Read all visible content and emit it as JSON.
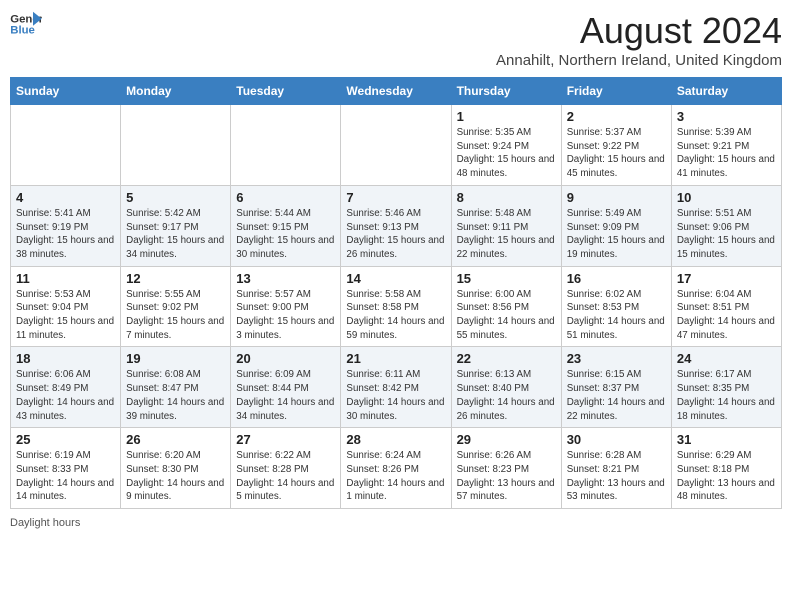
{
  "logo": {
    "line1": "General",
    "line2": "Blue"
  },
  "title": "August 2024",
  "location": "Annahilt, Northern Ireland, United Kingdom",
  "headers": [
    "Sunday",
    "Monday",
    "Tuesday",
    "Wednesday",
    "Thursday",
    "Friday",
    "Saturday"
  ],
  "weeks": [
    [
      {
        "day": "",
        "info": ""
      },
      {
        "day": "",
        "info": ""
      },
      {
        "day": "",
        "info": ""
      },
      {
        "day": "",
        "info": ""
      },
      {
        "day": "1",
        "info": "Sunrise: 5:35 AM\nSunset: 9:24 PM\nDaylight: 15 hours\nand 48 minutes."
      },
      {
        "day": "2",
        "info": "Sunrise: 5:37 AM\nSunset: 9:22 PM\nDaylight: 15 hours\nand 45 minutes."
      },
      {
        "day": "3",
        "info": "Sunrise: 5:39 AM\nSunset: 9:21 PM\nDaylight: 15 hours\nand 41 minutes."
      }
    ],
    [
      {
        "day": "4",
        "info": "Sunrise: 5:41 AM\nSunset: 9:19 PM\nDaylight: 15 hours\nand 38 minutes."
      },
      {
        "day": "5",
        "info": "Sunrise: 5:42 AM\nSunset: 9:17 PM\nDaylight: 15 hours\nand 34 minutes."
      },
      {
        "day": "6",
        "info": "Sunrise: 5:44 AM\nSunset: 9:15 PM\nDaylight: 15 hours\nand 30 minutes."
      },
      {
        "day": "7",
        "info": "Sunrise: 5:46 AM\nSunset: 9:13 PM\nDaylight: 15 hours\nand 26 minutes."
      },
      {
        "day": "8",
        "info": "Sunrise: 5:48 AM\nSunset: 9:11 PM\nDaylight: 15 hours\nand 22 minutes."
      },
      {
        "day": "9",
        "info": "Sunrise: 5:49 AM\nSunset: 9:09 PM\nDaylight: 15 hours\nand 19 minutes."
      },
      {
        "day": "10",
        "info": "Sunrise: 5:51 AM\nSunset: 9:06 PM\nDaylight: 15 hours\nand 15 minutes."
      }
    ],
    [
      {
        "day": "11",
        "info": "Sunrise: 5:53 AM\nSunset: 9:04 PM\nDaylight: 15 hours\nand 11 minutes."
      },
      {
        "day": "12",
        "info": "Sunrise: 5:55 AM\nSunset: 9:02 PM\nDaylight: 15 hours\nand 7 minutes."
      },
      {
        "day": "13",
        "info": "Sunrise: 5:57 AM\nSunset: 9:00 PM\nDaylight: 15 hours\nand 3 minutes."
      },
      {
        "day": "14",
        "info": "Sunrise: 5:58 AM\nSunset: 8:58 PM\nDaylight: 14 hours\nand 59 minutes."
      },
      {
        "day": "15",
        "info": "Sunrise: 6:00 AM\nSunset: 8:56 PM\nDaylight: 14 hours\nand 55 minutes."
      },
      {
        "day": "16",
        "info": "Sunrise: 6:02 AM\nSunset: 8:53 PM\nDaylight: 14 hours\nand 51 minutes."
      },
      {
        "day": "17",
        "info": "Sunrise: 6:04 AM\nSunset: 8:51 PM\nDaylight: 14 hours\nand 47 minutes."
      }
    ],
    [
      {
        "day": "18",
        "info": "Sunrise: 6:06 AM\nSunset: 8:49 PM\nDaylight: 14 hours\nand 43 minutes."
      },
      {
        "day": "19",
        "info": "Sunrise: 6:08 AM\nSunset: 8:47 PM\nDaylight: 14 hours\nand 39 minutes."
      },
      {
        "day": "20",
        "info": "Sunrise: 6:09 AM\nSunset: 8:44 PM\nDaylight: 14 hours\nand 34 minutes."
      },
      {
        "day": "21",
        "info": "Sunrise: 6:11 AM\nSunset: 8:42 PM\nDaylight: 14 hours\nand 30 minutes."
      },
      {
        "day": "22",
        "info": "Sunrise: 6:13 AM\nSunset: 8:40 PM\nDaylight: 14 hours\nand 26 minutes."
      },
      {
        "day": "23",
        "info": "Sunrise: 6:15 AM\nSunset: 8:37 PM\nDaylight: 14 hours\nand 22 minutes."
      },
      {
        "day": "24",
        "info": "Sunrise: 6:17 AM\nSunset: 8:35 PM\nDaylight: 14 hours\nand 18 minutes."
      }
    ],
    [
      {
        "day": "25",
        "info": "Sunrise: 6:19 AM\nSunset: 8:33 PM\nDaylight: 14 hours\nand 14 minutes."
      },
      {
        "day": "26",
        "info": "Sunrise: 6:20 AM\nSunset: 8:30 PM\nDaylight: 14 hours\nand 9 minutes."
      },
      {
        "day": "27",
        "info": "Sunrise: 6:22 AM\nSunset: 8:28 PM\nDaylight: 14 hours\nand 5 minutes."
      },
      {
        "day": "28",
        "info": "Sunrise: 6:24 AM\nSunset: 8:26 PM\nDaylight: 14 hours\nand 1 minute."
      },
      {
        "day": "29",
        "info": "Sunrise: 6:26 AM\nSunset: 8:23 PM\nDaylight: 13 hours\nand 57 minutes."
      },
      {
        "day": "30",
        "info": "Sunrise: 6:28 AM\nSunset: 8:21 PM\nDaylight: 13 hours\nand 53 minutes."
      },
      {
        "day": "31",
        "info": "Sunrise: 6:29 AM\nSunset: 8:18 PM\nDaylight: 13 hours\nand 48 minutes."
      }
    ]
  ],
  "footer": {
    "daylight_label": "Daylight hours"
  }
}
